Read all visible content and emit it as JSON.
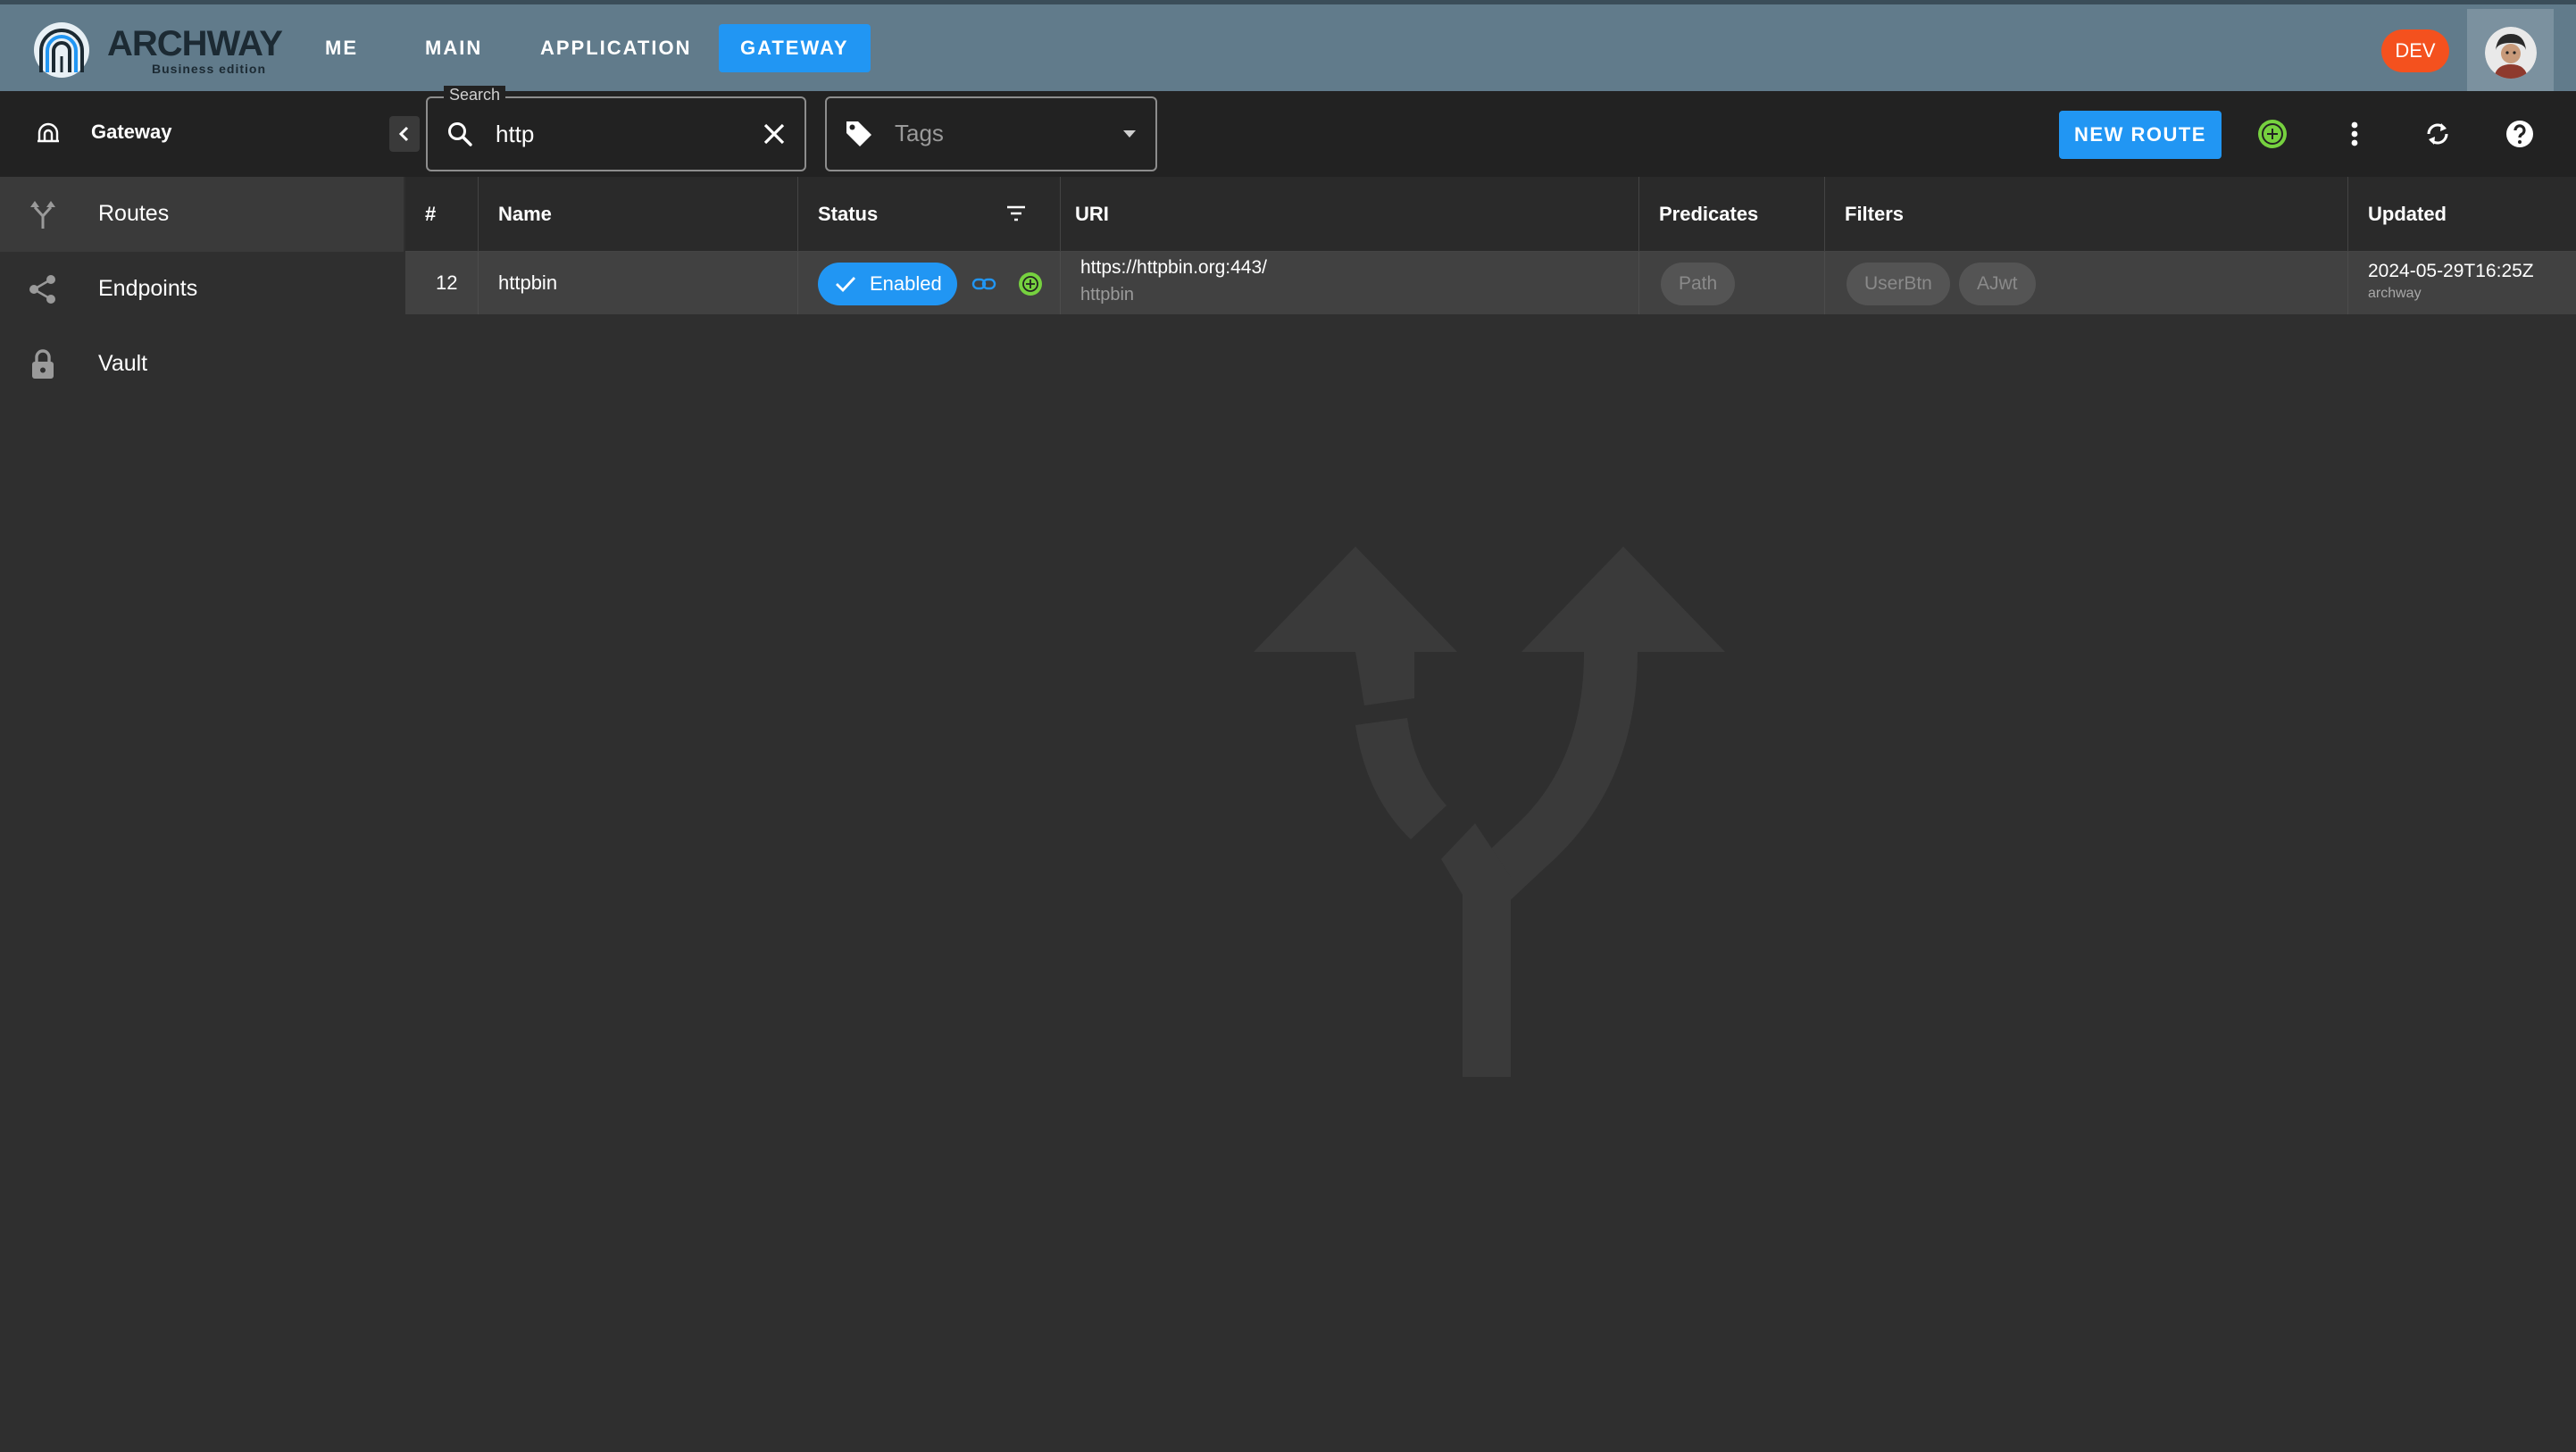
{
  "app": {
    "logo_text": "ARCHWAY",
    "logo_sub": "Business edition",
    "env_badge": "DEV"
  },
  "nav": {
    "items": [
      {
        "label": "ME"
      },
      {
        "label": "MAIN"
      },
      {
        "label": "APPLICATION"
      },
      {
        "label": "GATEWAY",
        "active": true
      }
    ]
  },
  "toolbar": {
    "breadcrumb": "Gateway",
    "search": {
      "legend": "Search",
      "value": "http"
    },
    "tags": {
      "placeholder": "Tags"
    },
    "new_route_label": "NEW ROUTE"
  },
  "sidebar": {
    "items": [
      {
        "label": "Routes",
        "icon": "fork-icon",
        "active": true
      },
      {
        "label": "Endpoints",
        "icon": "share-icon"
      },
      {
        "label": "Vault",
        "icon": "lock-icon"
      }
    ]
  },
  "table": {
    "columns": [
      "#",
      "Name",
      "Status",
      "URI",
      "Predicates",
      "Filters",
      "Updated"
    ],
    "rows": [
      {
        "id": "12",
        "name": "httpbin",
        "status": "Enabled",
        "uri": "https://httpbin.org:443/",
        "uri_sub": "httpbin",
        "predicates": [
          "Path"
        ],
        "filters": [
          "UserBtn",
          "AJwt"
        ],
        "updated": "2024-05-29T16:25Z",
        "updated_by": "archway"
      }
    ]
  },
  "colors": {
    "accent": "#2196f3",
    "topbar": "#617b8b",
    "badge": "#f4511e",
    "status_green": "#76d13f"
  }
}
